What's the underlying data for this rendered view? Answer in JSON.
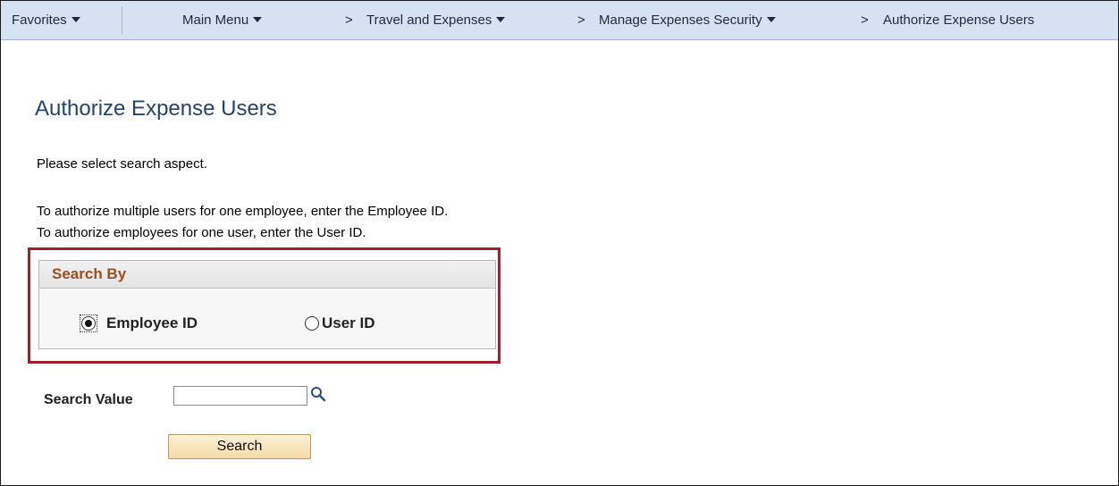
{
  "navbar": {
    "favorites": "Favorites",
    "main_menu": "Main Menu",
    "breadcrumb_1": "Travel and Expenses",
    "breadcrumb_2": "Manage Expenses Security",
    "breadcrumb_3": "Authorize Expense Users",
    "separator_glyph": ">"
  },
  "page": {
    "title": "Authorize Expense Users",
    "instruction": "Please select search aspect.",
    "help_line_1": "To authorize multiple users for one employee, enter the Employee ID.",
    "help_line_2": "To authorize employees for one user, enter the User ID."
  },
  "search_by": {
    "title": "Search By",
    "options": [
      {
        "label": "Employee ID",
        "checked": true
      },
      {
        "label": "User ID",
        "checked": false
      }
    ]
  },
  "search_value": {
    "label": "Search Value",
    "value": "",
    "lookup_icon": "magnifier-icon"
  },
  "search_button": {
    "label": "Search"
  },
  "colors": {
    "navbar_bg": "#d6e2f2",
    "title": "#24456b",
    "groupbox_title": "#9a4f1f",
    "highlight_border": "#a51d2d",
    "button_bg": "#f3d9a6"
  }
}
